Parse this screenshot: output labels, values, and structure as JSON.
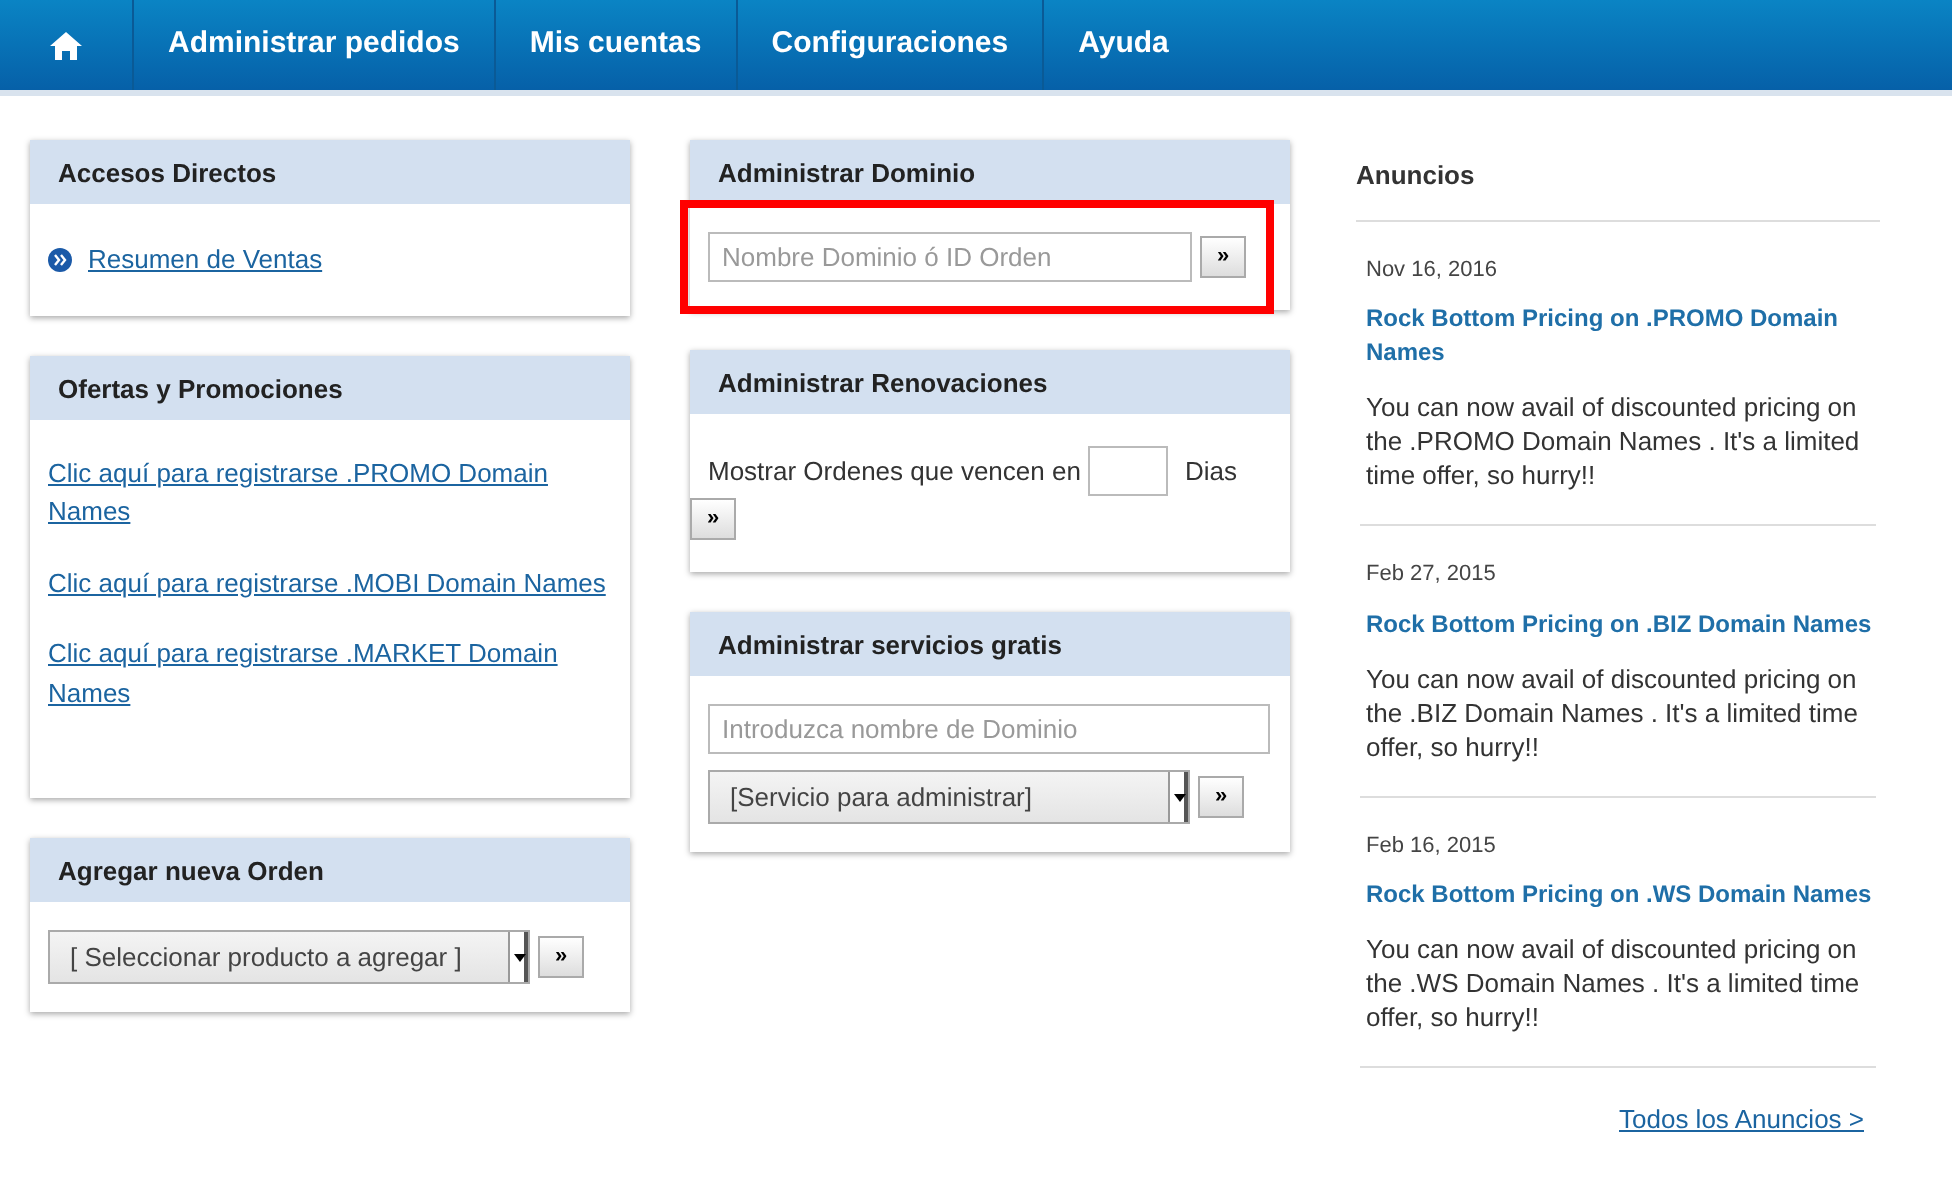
{
  "nav": {
    "items": [
      {
        "label": "Administrar pedidos"
      },
      {
        "label": "Mis cuentas"
      },
      {
        "label": "Configuraciones"
      },
      {
        "label": "Ayuda"
      }
    ]
  },
  "left_panels": [
    {
      "kind": "shortcuts",
      "title": "Accesos Directos",
      "links": [
        "Resumen de Ventas"
      ]
    },
    {
      "kind": "links",
      "title": "Ofertas y Promociones",
      "links": [
        "Clic aquí para registrarse .PROMO Domain Names",
        "Clic aquí para registrarse .MOBI Domain Names",
        "Clic aquí para registrarse .MARKET Domain Names"
      ]
    },
    {
      "kind": "select",
      "title": "Agregar nueva Orden",
      "select": "[ Seleccionar producto a agregar ]",
      "button": "»"
    }
  ],
  "middle_panels": [
    {
      "kind": "search",
      "title": "Administrar Dominio",
      "placeholder": "Nombre Dominio ó ID Orden",
      "button": "»",
      "highlighted": true
    },
    {
      "kind": "renewals",
      "title": "Administrar Renovaciones",
      "label_before": "Mostrar Ordenes que vencen en",
      "label_after": "Dias",
      "button": "»"
    },
    {
      "kind": "services",
      "title": "Administrar servicios gratis",
      "placeholder": "Introduzca nombre de Dominio",
      "select": "[Servicio para administrar]",
      "button": "»"
    }
  ],
  "announcements": {
    "title": "Anuncios",
    "items": [
      {
        "date": "Nov 16, 2016",
        "title": "Rock Bottom Pricing on .PROMO Domain Names",
        "body": "You can now avail of discounted pricing on the .PROMO Domain Names . It's a limited time offer, so hurry!!"
      },
      {
        "date": "Feb 27, 2015",
        "title": "Rock Bottom Pricing on .BIZ Domain Names",
        "body": "You can now avail of discounted pricing on the .BIZ Domain Names . It's a limited time offer, so hurry!!"
      },
      {
        "date": "Feb 16, 2015",
        "title": "Rock Bottom Pricing on .WS Domain Names",
        "body": "You can now avail of discounted pricing on the .WS Domain Names . It's a limited time offer, so hurry!!"
      }
    ],
    "all_link": "Todos los Anuncios >"
  }
}
